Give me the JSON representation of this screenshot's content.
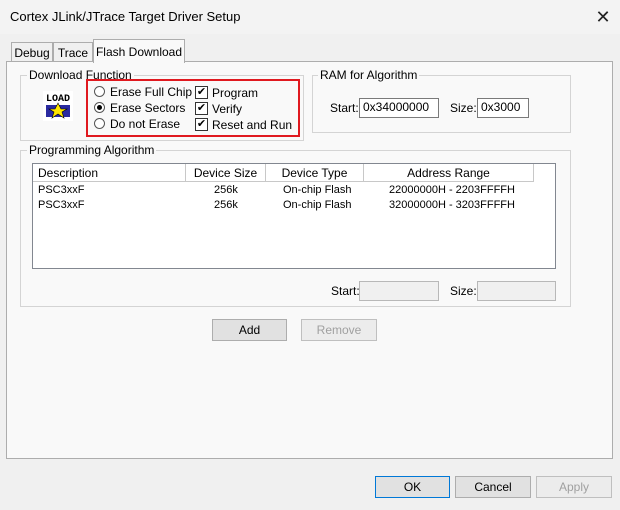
{
  "window": {
    "title": "Cortex JLink/JTrace Target Driver Setup",
    "close_glyph": "✕"
  },
  "tabs": [
    {
      "label": "Debug"
    },
    {
      "label": "Trace"
    },
    {
      "label": "Flash Download"
    }
  ],
  "download_function": {
    "label": "Download Function",
    "icon_text": "LOAD",
    "radios": [
      {
        "label": "Erase Full Chip",
        "selected": false
      },
      {
        "label": "Erase Sectors",
        "selected": true
      },
      {
        "label": "Do not Erase",
        "selected": false
      }
    ],
    "checks": [
      {
        "label": "Program",
        "checked": true
      },
      {
        "label": "Verify",
        "checked": true
      },
      {
        "label": "Reset and Run",
        "checked": true
      }
    ],
    "check_glyph": "✔"
  },
  "ram": {
    "label": "RAM for Algorithm",
    "start_label": "Start:",
    "start_value": "0x34000000",
    "size_label": "Size:",
    "size_value": "0x3000"
  },
  "algorithm": {
    "label": "Programming Algorithm",
    "columns": [
      "Description",
      "Device Size",
      "Device Type",
      "Address Range"
    ],
    "rows": [
      [
        "PSC3xxF",
        "256k",
        "On-chip Flash",
        "22000000H - 2203FFFFH"
      ],
      [
        "PSC3xxF",
        "256k",
        "On-chip Flash",
        "32000000H - 3203FFFFH"
      ]
    ],
    "start_label": "Start:",
    "start_value": "",
    "size_label": "Size:",
    "size_value": ""
  },
  "actions": {
    "add": "Add",
    "remove": "Remove"
  },
  "footer": {
    "ok": "OK",
    "cancel": "Cancel",
    "apply": "Apply"
  },
  "colors": {
    "highlight": "#e0191f",
    "default_button_border": "#0078d7"
  }
}
